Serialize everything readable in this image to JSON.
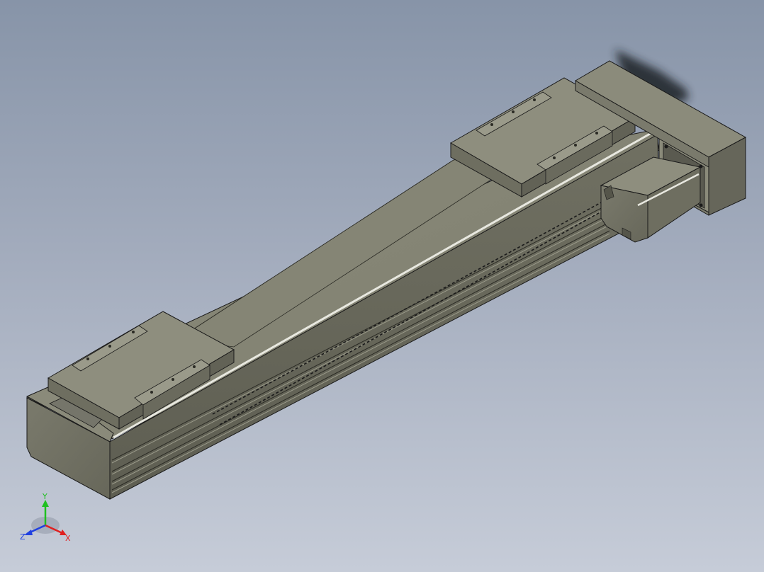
{
  "viewport": {
    "background_top": "#8794a8",
    "background_bottom": "#c6ccd8"
  },
  "model": {
    "body_color": "#7b7b6b",
    "face_light": "#8a8a7a",
    "face_dark": "#6b6b5c",
    "edge_color": "#1a1a1a",
    "highlight_color": "#e8e8e0",
    "shadow_color": "#2a2f36"
  },
  "triad": {
    "x_label": "X",
    "y_label": "Y",
    "z_label": "Z",
    "x_color": "#e02020",
    "y_color": "#20c020",
    "z_color": "#2040e0"
  }
}
